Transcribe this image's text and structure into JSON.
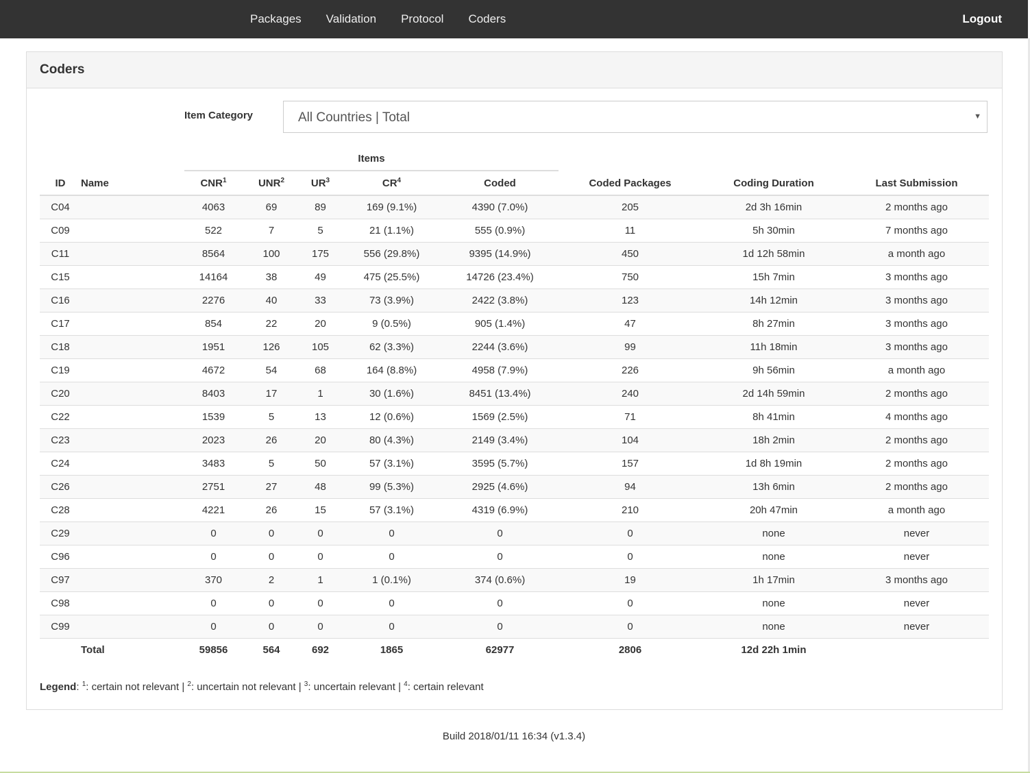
{
  "nav": {
    "items": [
      {
        "label": "Packages"
      },
      {
        "label": "Validation"
      },
      {
        "label": "Protocol"
      },
      {
        "label": "Coders"
      }
    ],
    "logout": "Logout"
  },
  "panel": {
    "title": "Coders",
    "category_label": "Item Category",
    "category_value": "All Countries | Total",
    "items_group": "Items"
  },
  "table": {
    "headers": {
      "id": "ID",
      "name": "Name",
      "cnr": "CNR",
      "cnr_sup": "1",
      "unr": "UNR",
      "unr_sup": "2",
      "ur": "UR",
      "ur_sup": "3",
      "cr": "CR",
      "cr_sup": "4",
      "coded": "Coded",
      "coded_packages": "Coded Packages",
      "coding_duration": "Coding Duration",
      "last_submission": "Last Submission"
    },
    "rows": [
      {
        "id": "C04",
        "name": "",
        "cnr": "4063",
        "unr": "69",
        "ur": "89",
        "cr": "169 (9.1%)",
        "coded": "4390 (7.0%)",
        "packages": "205",
        "duration": "2d 3h 16min",
        "last": "2 months ago"
      },
      {
        "id": "C09",
        "name": "",
        "cnr": "522",
        "unr": "7",
        "ur": "5",
        "cr": "21 (1.1%)",
        "coded": "555 (0.9%)",
        "packages": "11",
        "duration": "5h 30min",
        "last": "7 months ago"
      },
      {
        "id": "C11",
        "name": "",
        "cnr": "8564",
        "unr": "100",
        "ur": "175",
        "cr": "556 (29.8%)",
        "coded": "9395 (14.9%)",
        "packages": "450",
        "duration": "1d 12h 58min",
        "last": "a month ago"
      },
      {
        "id": "C15",
        "name": "",
        "cnr": "14164",
        "unr": "38",
        "ur": "49",
        "cr": "475 (25.5%)",
        "coded": "14726 (23.4%)",
        "packages": "750",
        "duration": "15h 7min",
        "last": "3 months ago"
      },
      {
        "id": "C16",
        "name": "",
        "cnr": "2276",
        "unr": "40",
        "ur": "33",
        "cr": "73 (3.9%)",
        "coded": "2422 (3.8%)",
        "packages": "123",
        "duration": "14h 12min",
        "last": "3 months ago"
      },
      {
        "id": "C17",
        "name": "",
        "cnr": "854",
        "unr": "22",
        "ur": "20",
        "cr": "9 (0.5%)",
        "coded": "905 (1.4%)",
        "packages": "47",
        "duration": "8h 27min",
        "last": "3 months ago"
      },
      {
        "id": "C18",
        "name": "",
        "cnr": "1951",
        "unr": "126",
        "ur": "105",
        "cr": "62 (3.3%)",
        "coded": "2244 (3.6%)",
        "packages": "99",
        "duration": "11h 18min",
        "last": "3 months ago"
      },
      {
        "id": "C19",
        "name": "",
        "cnr": "4672",
        "unr": "54",
        "ur": "68",
        "cr": "164 (8.8%)",
        "coded": "4958 (7.9%)",
        "packages": "226",
        "duration": "9h 56min",
        "last": "a month ago"
      },
      {
        "id": "C20",
        "name": "",
        "cnr": "8403",
        "unr": "17",
        "ur": "1",
        "cr": "30 (1.6%)",
        "coded": "8451 (13.4%)",
        "packages": "240",
        "duration": "2d 14h 59min",
        "last": "2 months ago"
      },
      {
        "id": "C22",
        "name": "",
        "cnr": "1539",
        "unr": "5",
        "ur": "13",
        "cr": "12 (0.6%)",
        "coded": "1569 (2.5%)",
        "packages": "71",
        "duration": "8h 41min",
        "last": "4 months ago"
      },
      {
        "id": "C23",
        "name": "",
        "cnr": "2023",
        "unr": "26",
        "ur": "20",
        "cr": "80 (4.3%)",
        "coded": "2149 (3.4%)",
        "packages": "104",
        "duration": "18h 2min",
        "last": "2 months ago"
      },
      {
        "id": "C24",
        "name": "",
        "cnr": "3483",
        "unr": "5",
        "ur": "50",
        "cr": "57 (3.1%)",
        "coded": "3595 (5.7%)",
        "packages": "157",
        "duration": "1d 8h 19min",
        "last": "2 months ago"
      },
      {
        "id": "C26",
        "name": "",
        "cnr": "2751",
        "unr": "27",
        "ur": "48",
        "cr": "99 (5.3%)",
        "coded": "2925 (4.6%)",
        "packages": "94",
        "duration": "13h 6min",
        "last": "2 months ago"
      },
      {
        "id": "C28",
        "name": "",
        "cnr": "4221",
        "unr": "26",
        "ur": "15",
        "cr": "57 (3.1%)",
        "coded": "4319 (6.9%)",
        "packages": "210",
        "duration": "20h 47min",
        "last": "a month ago"
      },
      {
        "id": "C29",
        "name": "",
        "cnr": "0",
        "unr": "0",
        "ur": "0",
        "cr": "0",
        "coded": "0",
        "packages": "0",
        "duration": "none",
        "last": "never"
      },
      {
        "id": "C96",
        "name": "",
        "cnr": "0",
        "unr": "0",
        "ur": "0",
        "cr": "0",
        "coded": "0",
        "packages": "0",
        "duration": "none",
        "last": "never"
      },
      {
        "id": "C97",
        "name": "",
        "cnr": "370",
        "unr": "2",
        "ur": "1",
        "cr": "1 (0.1%)",
        "coded": "374 (0.6%)",
        "packages": "19",
        "duration": "1h 17min",
        "last": "3 months ago"
      },
      {
        "id": "C98",
        "name": "",
        "cnr": "0",
        "unr": "0",
        "ur": "0",
        "cr": "0",
        "coded": "0",
        "packages": "0",
        "duration": "none",
        "last": "never"
      },
      {
        "id": "C99",
        "name": "",
        "cnr": "0",
        "unr": "0",
        "ur": "0",
        "cr": "0",
        "coded": "0",
        "packages": "0",
        "duration": "none",
        "last": "never"
      }
    ],
    "total": {
      "label": "Total",
      "cnr": "59856",
      "unr": "564",
      "ur": "692",
      "cr": "1865",
      "coded": "62977",
      "packages": "2806",
      "duration": "12d 22h 1min",
      "last": ""
    }
  },
  "legend": {
    "label": "Legend",
    "items": [
      {
        "sup": "1",
        "text": ": certain not relevant"
      },
      {
        "sup": "2",
        "text": ": uncertain not relevant"
      },
      {
        "sup": "3",
        "text": ": uncertain relevant"
      },
      {
        "sup": "4",
        "text": ": certain relevant"
      }
    ],
    "separator": " | "
  },
  "footer": {
    "build": "Build 2018/01/11 16:34 (v1.3.4)"
  }
}
